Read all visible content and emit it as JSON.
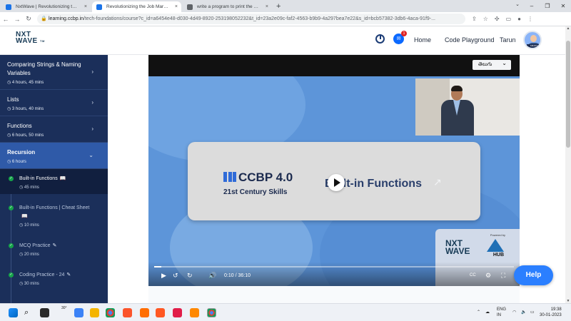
{
  "browser": {
    "tabs": [
      {
        "label": "NxtWave | Revolutionizing the Jo",
        "fav_color": "#1a73e8",
        "active": false
      },
      {
        "label": "Revolutionizing the Job Market |",
        "fav_color": "#1a73e8",
        "active": true
      },
      {
        "label": "write a program to print the kth",
        "fav_color": "#5f6368",
        "active": false
      }
    ],
    "close_glyph": "×",
    "new_tab": "+",
    "url_host": "learning.ccbp.in",
    "url_path": "/tech-foundations/course?c_id=a6454e48-d030-4d49-8920-253198052232&t_id=23a2e09c-faf2-4563-b9b9-4a297bea7e22&s_id=bcb57382-3db6-4aca-91f9-..."
  },
  "header": {
    "logo_line1": "NXT",
    "logo_line2": "WAVE",
    "logo_tm": "TM",
    "chat_badge": "1",
    "nav": [
      "Home",
      "Code Playground",
      "Tarun"
    ],
    "avatar_tag": "SMART"
  },
  "sidebar": {
    "modules": [
      {
        "title": "Comparing Strings & Naming Variables",
        "duration": "4 hours, 45 mins"
      },
      {
        "title": "Lists",
        "duration": "3 hours, 40 mins"
      },
      {
        "title": "Functions",
        "duration": "6 hours, 50 mins"
      }
    ],
    "active_module": {
      "title": "Recursion",
      "duration": "6 hours"
    },
    "lessons": [
      {
        "title": "Built-in Functions",
        "duration": "45 mins",
        "icon": "📖"
      },
      {
        "title": "Built-in Functions | Cheat Sheet",
        "duration": "10 mins",
        "icon": "📖"
      },
      {
        "title": "MCQ Practice",
        "duration": "20 mins",
        "icon": "✎"
      },
      {
        "title": "Coding Practice - 24",
        "duration": "30 mins",
        "icon": "✎"
      }
    ],
    "chevron": "›",
    "chevron_open": "⌄"
  },
  "video": {
    "language": "తెలుగు",
    "ccbp": "CCBP 4.0",
    "century": "21st Century Skills",
    "slide_title": "Built-in Functions",
    "powered_by": "Powered by",
    "nw_line1": "NXT",
    "nw_line2": "WAVE",
    "hub": "HUB",
    "current_time": "0:10",
    "total_time": "36:10",
    "progress": 0.005,
    "separator": "/",
    "cc_label": "CC"
  },
  "help_label": "Help",
  "taskbar": {
    "weather": "30°",
    "lang1": "ENG",
    "lang2": "IN",
    "time": "19:38",
    "date": "30-01-2023"
  }
}
